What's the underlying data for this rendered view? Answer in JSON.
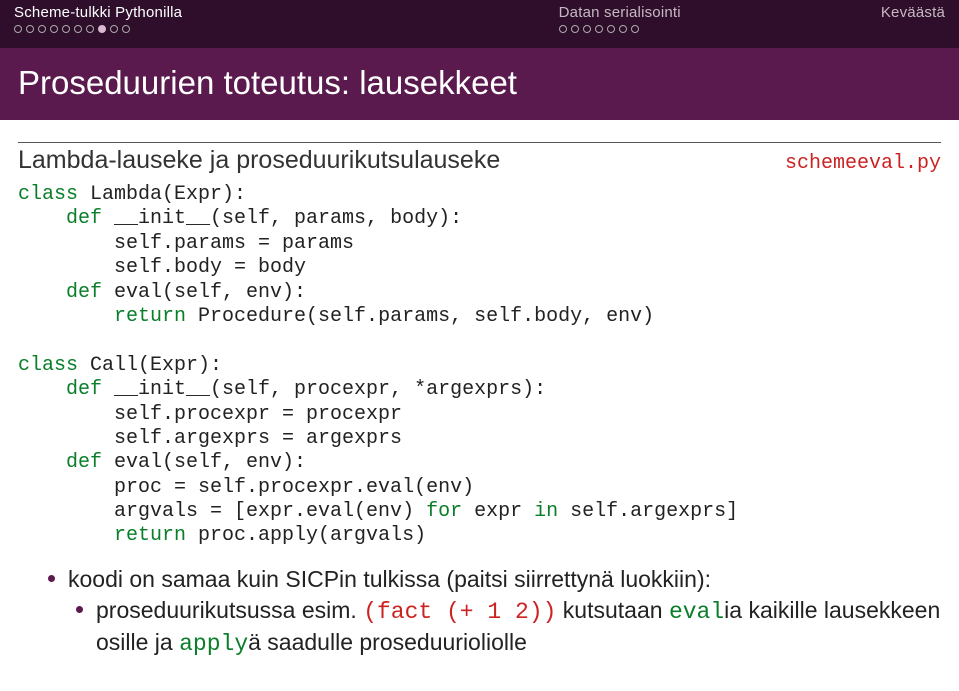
{
  "header": {
    "sections": [
      {
        "label": "Scheme-tulkki Pythonilla",
        "progress_total": 10,
        "progress_current": 8,
        "active": true
      },
      {
        "label": "Datan serialisointi",
        "progress_total": 7,
        "progress_current": 0,
        "active": false
      },
      {
        "label": "Keväästä",
        "progress_total": 0,
        "progress_current": 0,
        "active": false
      }
    ]
  },
  "title": "Proseduurien toteutus: lausekkeet",
  "block": {
    "heading": "Lambda-lauseke ja proseduurikutsulauseke",
    "tag": "schemeeval.py"
  },
  "code": {
    "l01a": "class",
    "l01b": " Lambda(Expr):",
    "l02a": "    def",
    "l02b": " __init__(self, params, body):",
    "l03": "        self.params = params",
    "l04": "        self.body = body",
    "l05a": "    def",
    "l05b": " eval(self, env):",
    "l06a": "        return",
    "l06b": " Procedure(self.params, self.body, env)",
    "blank1": "",
    "l07a": "class",
    "l07b": " Call(Expr):",
    "l08a": "    def",
    "l08b": " __init__(self, procexpr, *argexprs):",
    "l09": "        self.procexpr = procexpr",
    "l10": "        self.argexprs = argexprs",
    "l11a": "    def",
    "l11b": " eval(self, env):",
    "l12": "        proc = self.procexpr.eval(env)",
    "l13a": "        argvals = [expr.eval(env) ",
    "l13b": "for",
    "l13c": " expr ",
    "l13d": "in",
    "l13e": " self.argexprs]",
    "l14a": "        return",
    "l14b": " proc.apply(argvals)"
  },
  "bullets": {
    "b1": "koodi on samaa kuin SICPin tulkissa (paitsi siirrettynä luokkiin):",
    "b2_a": "proseduurikutsussa esim. ",
    "b2_b": "(fact (+ 1 2))",
    "b2_c": " kutsutaan ",
    "b2_d": "eval",
    "b2_e": "ia kaikille lausekkeen osille ja ",
    "b2_f": "apply",
    "b2_g": "ä saadulle proseduurioliolle"
  }
}
